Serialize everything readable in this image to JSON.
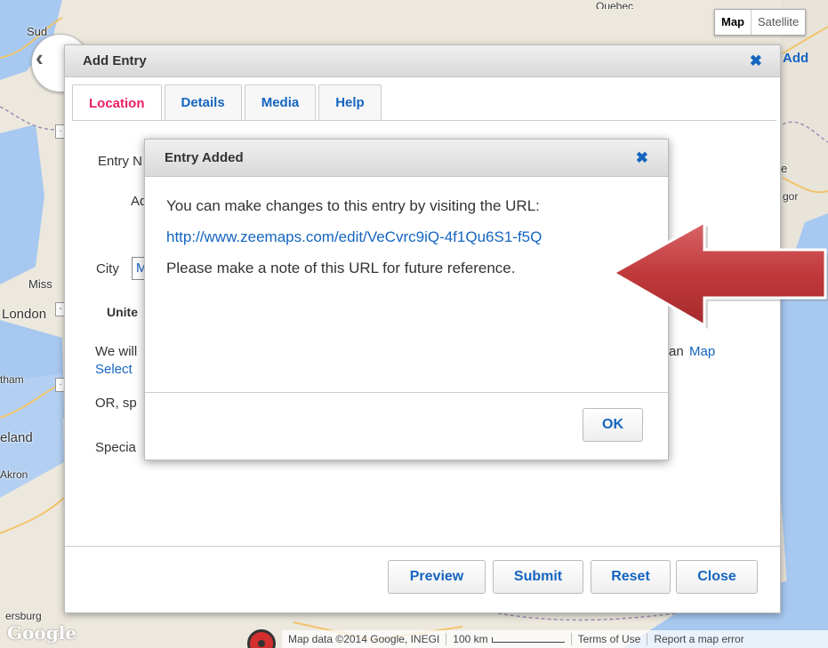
{
  "map": {
    "type_buttons": [
      "Map",
      "Satellite"
    ],
    "labels": [
      "Sud",
      "Miss",
      "London",
      "tham",
      "eland",
      "Akron",
      "ersburg",
      "gor",
      "e",
      "Quebec"
    ],
    "add_link": "Add",
    "attribution": "Map data ©2014 Google, INEGI",
    "scale": "100 km",
    "terms": "Terms of Use",
    "report": "Report a map error",
    "google_logo": "Google",
    "colors": {
      "water": "#a7c8f0",
      "land": "#ece8dd",
      "road": "#f2c46b",
      "border": "#9e8fb8"
    }
  },
  "add_entry": {
    "title": "Add Entry",
    "close_icon": "close-x-icon",
    "tabs": [
      "Location",
      "Details",
      "Media",
      "Help"
    ],
    "active_tab": "Location",
    "fragments": {
      "entry_name": "Entry N",
      "address": "Ad",
      "city": "City",
      "city_value": "M",
      "country": "Unite",
      "we_will": "We will",
      "select": "Select",
      "or_spec": "OR, sp",
      "special": "Specia",
      "an_map": "an",
      "map_link": "Map"
    },
    "buttons": {
      "preview": "Preview",
      "submit": "Submit",
      "reset": "Reset",
      "close": "Close"
    }
  },
  "entry_added": {
    "title": "Entry Added",
    "close_icon": "close-x-icon",
    "message": "You can make changes to this entry by visiting the URL:",
    "url": "http://www.zeemaps.com/edit/VeCvrc9iQ-4f1Qu6S1-f5Q",
    "note": "Please make a note of this URL for future reference.",
    "ok": "OK"
  },
  "annotation": {
    "arrow_color": "#c0393b",
    "direction": "pointing-left"
  }
}
